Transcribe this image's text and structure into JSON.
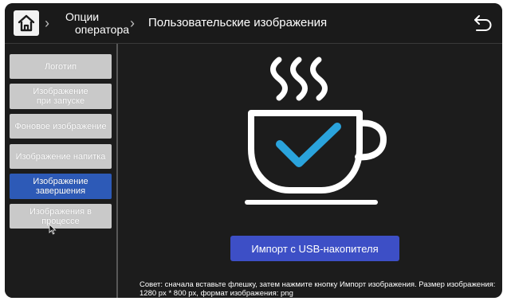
{
  "header": {
    "home_icon": "home-icon",
    "crumb_options_line1": "Опции",
    "crumb_options_line2": "оператора",
    "separator": "›",
    "title": "Пользовательские изображения",
    "back_icon": "undo-back-icon"
  },
  "sidebar": {
    "items": [
      {
        "label": "Логотип",
        "active": false
      },
      {
        "label": "Изображение\nпри запуске",
        "active": false
      },
      {
        "label": "Фоновое изображение",
        "active": false
      },
      {
        "label": "Изображение напитка",
        "active": false
      },
      {
        "label": "Изображение\nзавершения",
        "active": true
      },
      {
        "label": "Изображения в\nпроцессе",
        "active": false
      }
    ]
  },
  "main": {
    "preview_icon": "coffee-cup-checkmark-icon",
    "import_button": "Импорт с USB-накопителя",
    "tip": "Совет: сначала вставьте флешку, затем нажмите кнопку Импорт изображения. Размер изображения: 1280 px * 800 px, формат изображения: png"
  },
  "colors": {
    "background": "#1c1c1c",
    "sidebar_button": "#c9c9c9",
    "sidebar_button_active": "#2d5ab7",
    "import_button": "#3d4fc6",
    "checkmark": "#2aa3dc"
  }
}
